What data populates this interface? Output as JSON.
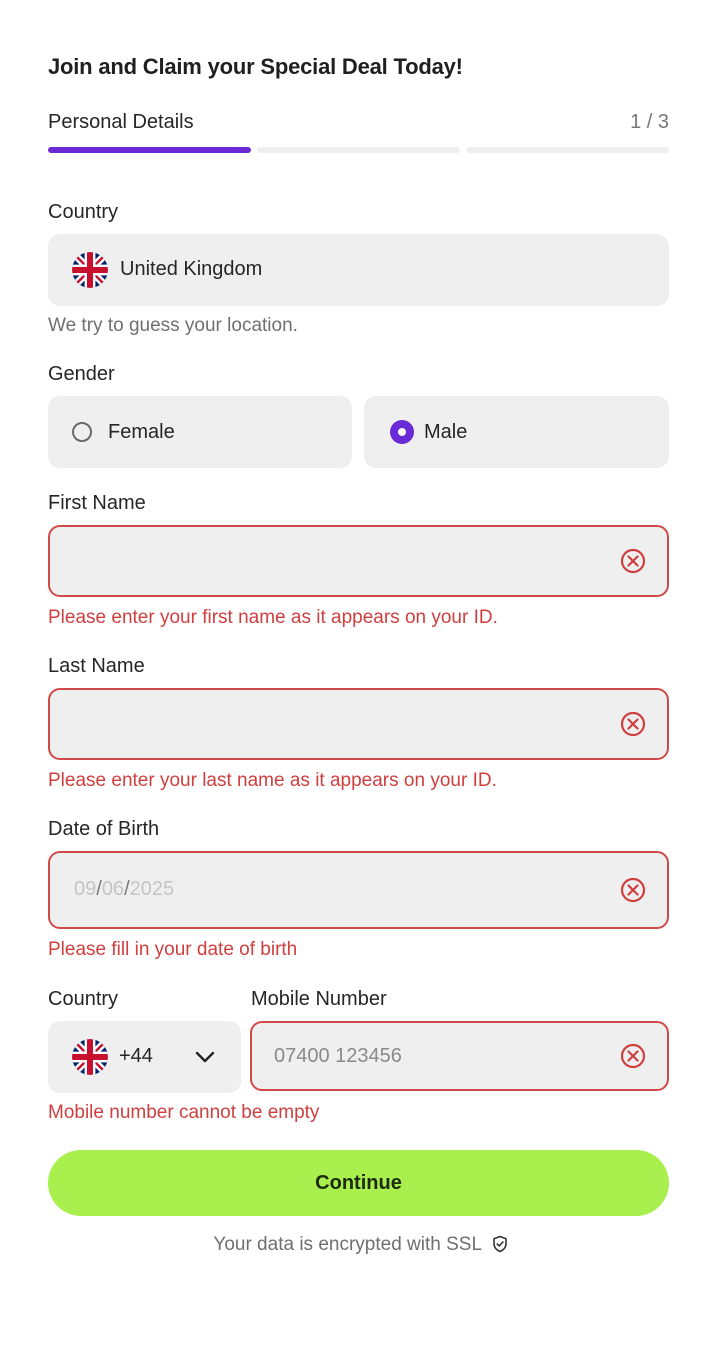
{
  "header": {
    "title": "Join and Claim your Special Deal Today!",
    "step_label": "Personal Details",
    "step_count": "1 / 3",
    "progress": {
      "current_step": 1,
      "total_steps": 3
    }
  },
  "country": {
    "label": "Country",
    "value": "United Kingdom",
    "flag_icon": "uk-flag-icon",
    "hint": "We try to guess your location."
  },
  "gender": {
    "label": "Gender",
    "options": [
      {
        "label": "Female",
        "selected": false
      },
      {
        "label": "Male",
        "selected": true
      }
    ]
  },
  "first_name": {
    "label": "First Name",
    "value": "",
    "error": "Please enter your first name as it appears on your ID."
  },
  "last_name": {
    "label": "Last Name",
    "value": "",
    "error": "Please enter your last name as it appears on your ID."
  },
  "dob": {
    "label": "Date of Birth",
    "day_placeholder": "09",
    "month_placeholder": "06",
    "year_placeholder": "2025",
    "separator": "/",
    "error": "Please fill in your date of birth"
  },
  "phone": {
    "country_label": "Country",
    "dial_code": "+44",
    "number_label": "Mobile Number",
    "placeholder": "07400 123456",
    "error": "Mobile number cannot be empty"
  },
  "actions": {
    "continue_label": "Continue"
  },
  "footer": {
    "ssl_text": "Your data is encrypted with SSL",
    "ssl_icon": "shield-check-icon"
  },
  "colors": {
    "accent": "#6a2bd6",
    "error": "#cf3f3f",
    "cta": "#a9f04f",
    "field_bg": "#efefef"
  }
}
